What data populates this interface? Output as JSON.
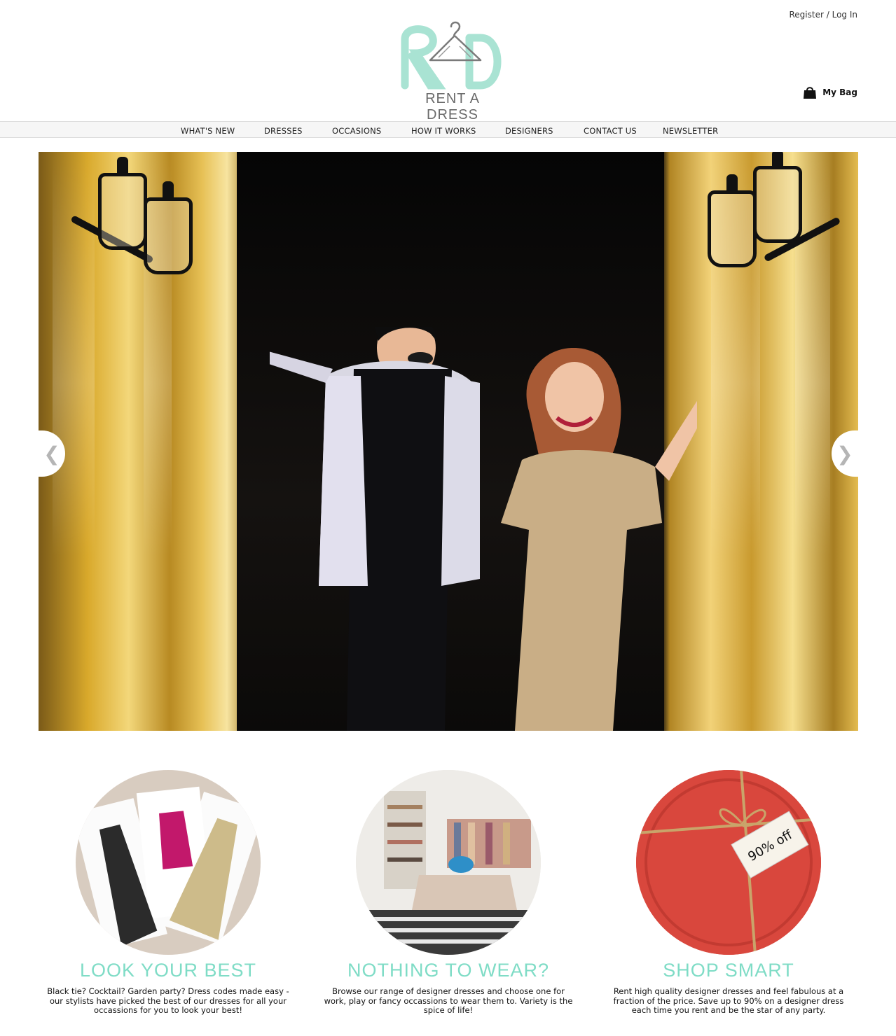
{
  "header": {
    "register": "Register",
    "separator": "/",
    "login": "Log In",
    "logo_monogram": "RD",
    "logo_text": "RENT A DRESS",
    "my_bag": "My Bag"
  },
  "nav": {
    "items": [
      {
        "label": "WHAT'S NEW"
      },
      {
        "label": "DRESSES"
      },
      {
        "label": "OCCASIONS"
      },
      {
        "label": "HOW IT WORKS"
      },
      {
        "label": "DESIGNERS"
      },
      {
        "label": "CONTACT US"
      },
      {
        "label": "NEWSLETTER"
      }
    ]
  },
  "hero": {
    "prev_icon": "chevron-left-icon",
    "next_icon": "chevron-right-icon"
  },
  "features": [
    {
      "title": "LOOK YOUR BEST",
      "description": "Black tie? Cocktail? Garden party? Dress codes made easy - our stylists have picked the best of our dresses for all your occassions for you to look your best!"
    },
    {
      "title": "NOTHING TO WEAR?",
      "description": "Browse our range of designer dresses and choose one for work, play or fancy occassions to wear them to. Variety is the spice of life!"
    },
    {
      "title": "SHOP SMART",
      "description": "Rent high quality designer dresses and feel fabulous at a fraction of the price. Save up to 90% on a designer dress each time you rent and be the star of any party.",
      "tag_text": "90% off"
    }
  ],
  "colors": {
    "accent_mint": "#7fdcc6",
    "logo_mint": "#a9e3d3",
    "nav_bg": "#f6f6f6"
  }
}
